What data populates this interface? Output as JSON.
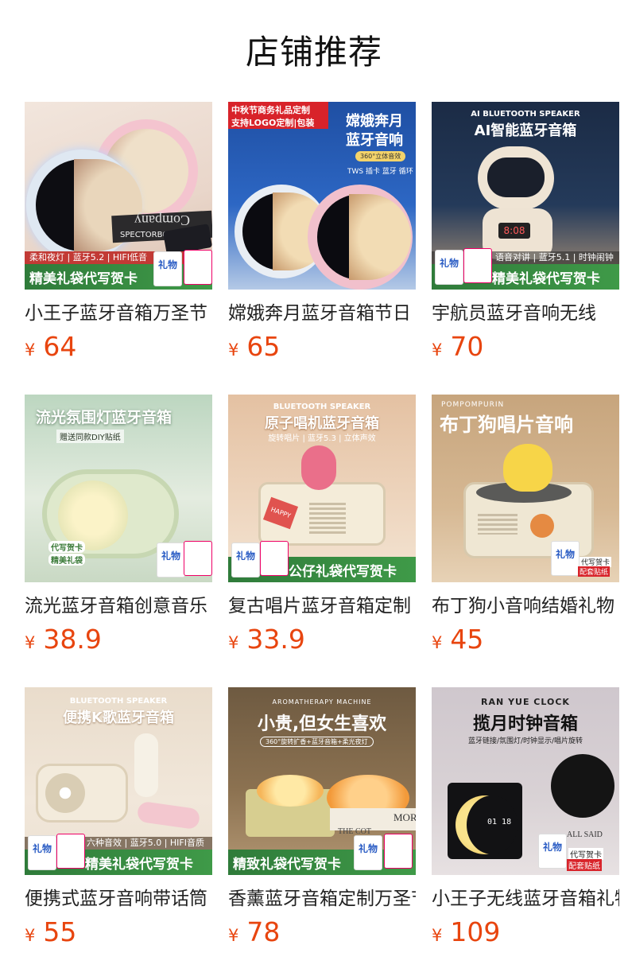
{
  "page": {
    "title": "店铺推荐"
  },
  "currency_symbol": "¥",
  "products": [
    {
      "title": "小王子蓝牙音箱万圣节",
      "price": "64",
      "art": {
        "band": "精美礼袋代写贺卡",
        "features": "柔和夜灯 | 蓝牙5.2 | HIFI低音",
        "book": "Company",
        "book2": "SPECTORBOOKS",
        "bag_label": "礼物"
      }
    },
    {
      "title": "嫦娥奔月蓝牙音箱节日",
      "price": "65",
      "art": {
        "headline": "嫦娥奔月",
        "headline2": "蓝牙音响",
        "badge_line1": "中秋节商务礼品定制",
        "badge_line2": "支持LOGO定制|包装",
        "pill": "360°立体音效",
        "spec": "TWS 插卡 蓝牙 循环"
      }
    },
    {
      "title": "宇航员蓝牙音响无线",
      "price": "70",
      "art": {
        "sub": "AI BLUETOOTH SPEAKER",
        "headline": "AI智能蓝牙音箱",
        "band": "精美礼袋代写贺卡",
        "features": "语音对讲 | 蓝牙5.1 | 时钟闹钟",
        "clock": "8:08",
        "bag_label": "礼物"
      }
    },
    {
      "title": "流光蓝牙音箱创意音乐",
      "price": "38.9",
      "art": {
        "headline": "流光氛围灯蓝牙音箱",
        "sub": "赠送同款DIY贴纸",
        "sticker1": "代写贺卡",
        "sticker2": "精美礼袋",
        "bag_label": "礼物"
      }
    },
    {
      "title": "复古唱片蓝牙音箱定制",
      "price": "33.9",
      "art": {
        "sub": "BLUETOOTH SPEAKER",
        "headline": "原子唱机蓝牙音箱",
        "features": "旋转唱片 | 蓝牙5.3 | 立体声效",
        "band": "公仔礼袋代写贺卡",
        "sticker": "HAPPY",
        "bag_label": "礼物"
      }
    },
    {
      "title": "布丁狗小音响结婚礼物",
      "price": "45",
      "art": {
        "sub": "POMPOMPURIN",
        "headline": "布丁狗唱片音响",
        "tag1": "代写贺卡",
        "tag2": "配套贴纸",
        "bag_label": "礼物"
      }
    },
    {
      "title": "便携式蓝牙音响带话筒",
      "price": "55",
      "art": {
        "sub": "BLUETOOTH SPEAKER",
        "headline": "便携K歌蓝牙音箱",
        "features": "六种音效 | 蓝牙5.0 | HIFI音质",
        "band": "精美礼袋代写贺卡",
        "bag_label": "礼物"
      }
    },
    {
      "title": "香薰蓝牙音箱定制万圣节",
      "price": "78",
      "art": {
        "sub": "AROMATHERAPY MACHINE",
        "headline": "小贵,但女生喜欢",
        "pill": "360°旋转扩香+蓝牙音箱+柔光夜灯",
        "band": "精致礼袋代写贺卡",
        "book": "MOR",
        "book2": "THE COT",
        "bag_label": "礼物"
      }
    },
    {
      "title": "小王子无线蓝牙音箱礼物",
      "price": "109",
      "art": {
        "sub": "RAN YUE CLOCK",
        "headline": "揽月时钟音箱",
        "features": "蓝牙链接/氛围灯/时钟显示/唱片旋转",
        "clock": "01 18",
        "tag1": "代写贺卡",
        "tag2": "配套贴纸",
        "bag_label": "礼物",
        "book": "ALL SAID"
      }
    }
  ]
}
